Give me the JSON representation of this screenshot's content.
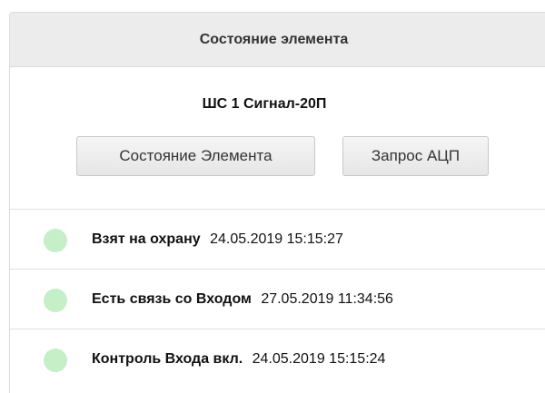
{
  "panel": {
    "title": "Состояние элемента",
    "device_name": "ШС 1 Сигнал-20П"
  },
  "buttons": {
    "element_state": "Состояние Элемента",
    "adc_request": "Запрос АЦП"
  },
  "status_items": [
    {
      "event": "Взят на охрану",
      "timestamp": "24.05.2019 15:15:27",
      "indicator": "green-dot"
    },
    {
      "event": "Есть связь со Входом",
      "timestamp": "27.05.2019 11:34:56",
      "indicator": "green-dot"
    },
    {
      "event": "Контроль Входа вкл.",
      "timestamp": "24.05.2019 15:15:24",
      "indicator": "green-dot"
    }
  ],
  "colors": {
    "header_bg": "#ececec",
    "status_ok": "#c4efc7",
    "border": "#dcdcdc"
  }
}
